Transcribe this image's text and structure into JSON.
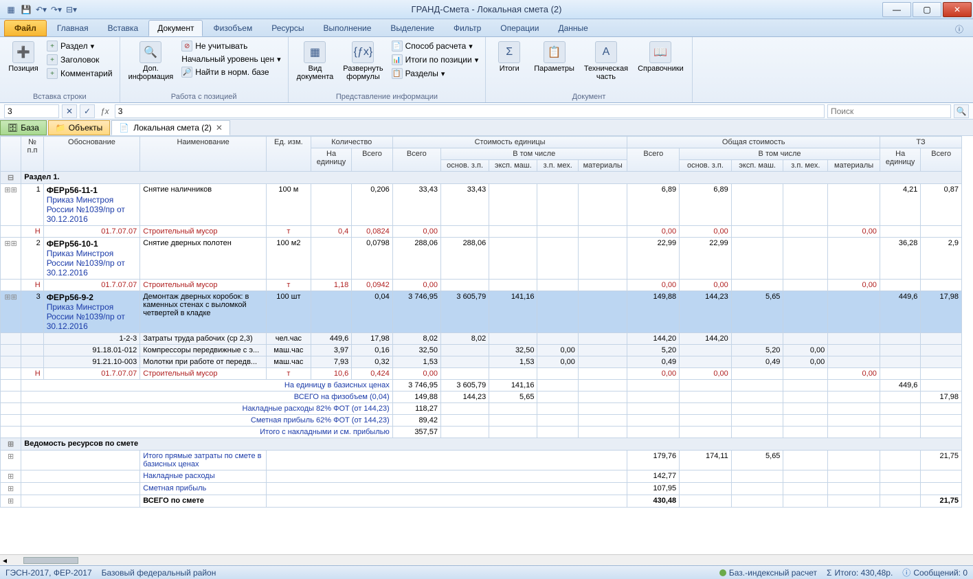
{
  "title": "ГРАНД-Смета - Локальная смета (2)",
  "ribbon": {
    "file": "Файл",
    "tabs": [
      "Главная",
      "Вставка",
      "Документ",
      "Физобъем",
      "Ресурсы",
      "Выполнение",
      "Выделение",
      "Фильтр",
      "Операции",
      "Данные"
    ],
    "active": "Документ",
    "g1": {
      "title": "Вставка строки",
      "pos": "Позиция",
      "razdel": "Раздел",
      "zag": "Заголовок",
      "kom": "Комментарий"
    },
    "g2": {
      "title": "Работа с позицией",
      "dop": "Доп.\nинформация",
      "neuch": "Не учитывать",
      "nach": "Начальный уровень цен",
      "find": "Найти в норм. базе"
    },
    "g3": {
      "title": "Представление информации",
      "vid": "Вид\nдокумента",
      "razv": "Развернуть\nформулы",
      "sposob": "Способ расчета",
      "itogipos": "Итоги по позиции",
      "razdely": "Разделы"
    },
    "g4": {
      "title": "Документ",
      "itogi": "Итоги",
      "param": "Параметры",
      "tech": "Техническая\nчасть",
      "sprav": "Справочники"
    }
  },
  "fbar": {
    "name": "3",
    "formula": "3",
    "search": "Поиск"
  },
  "tabstrip": {
    "baza": "База",
    "obj": "Объекты",
    "doc": "Локальная смета (2)"
  },
  "headers": {
    "num": "№\nп.п",
    "obos": "Обоснование",
    "naim": "Наименование",
    "ed": "Ед. изм.",
    "kol": "Количество",
    "kol_ed": "На\nединицу",
    "kol_vs": "Всего",
    "stoim": "Стоимость единицы",
    "vs": "Всего",
    "vtom": "В том числе",
    "osn": "основ. з.п.",
    "eksp": "эксп. маш.",
    "zpmeh": "з.п. мех.",
    "mat": "материалы",
    "obsh": "Общая стоимость",
    "tz": "ТЗ",
    "tz_ed": "На\nединицу",
    "tz_vs": "Всего"
  },
  "section1": "Раздел 1.",
  "rows": [
    {
      "n": "1",
      "code": "ФЕРр56-11-1",
      "prik": "Приказ Минстроя России №1039/пр от 30.12.2016",
      "name": "Снятие наличников",
      "ed": "100 м",
      "ke": "",
      "kv": "0,206",
      "se_vs": "33,43",
      "se_osn": "33,43",
      "se_em": "",
      "se_zpm": "",
      "se_mat": "",
      "o_vs": "6,89",
      "o_osn": "6,89",
      "o_em": "",
      "o_zpm": "",
      "o_mat": "",
      "tz_e": "4,21",
      "tz_v": "0,87"
    },
    {
      "type": "res",
      "h": "Н",
      "code": "01.7.07.07",
      "name": "Строительный мусор",
      "ed": "т",
      "ke": "0,4",
      "kv": "0,0824",
      "se_vs": "0,00",
      "o_vs": "0,00",
      "o_osn": "0,00",
      "o_mat": "0,00"
    },
    {
      "n": "2",
      "code": "ФЕРр56-10-1",
      "prik": "Приказ Минстроя России №1039/пр от 30.12.2016",
      "name": "Снятие дверных полотен",
      "ed": "100 м2",
      "ke": "",
      "kv": "0,0798",
      "se_vs": "288,06",
      "se_osn": "288,06",
      "o_vs": "22,99",
      "o_osn": "22,99",
      "tz_e": "36,28",
      "tz_v": "2,9"
    },
    {
      "type": "res",
      "h": "Н",
      "code": "01.7.07.07",
      "name": "Строительный мусор",
      "ed": "т",
      "ke": "1,18",
      "kv": "0,0942",
      "se_vs": "0,00",
      "o_vs": "0,00",
      "o_osn": "0,00",
      "o_mat": "0,00"
    },
    {
      "n": "3",
      "sel": true,
      "code": "ФЕРр56-9-2",
      "prik": "Приказ Минстроя России №1039/пр от 30.12.2016",
      "name": "Демонтаж дверных коробок: в каменных стенах с выломкой четвертей в кладке",
      "ed": "100 шт",
      "ke": "",
      "kv": "0,04",
      "se_vs": "3 746,95",
      "se_osn": "3 605,79",
      "se_em": "141,16",
      "o_vs": "149,88",
      "o_osn": "144,23",
      "o_em": "5,65",
      "tz_e": "449,6",
      "tz_v": "17,98"
    },
    {
      "type": "sub",
      "code": "1-2-3",
      "name": "Затраты труда рабочих (ср 2,3)",
      "ed": "чел.час",
      "ke": "449,6",
      "kv": "17,98",
      "se_vs": "8,02",
      "se_osn": "8,02",
      "o_vs": "144,20",
      "o_osn": "144,20"
    },
    {
      "type": "sub",
      "code": "91.18.01-012",
      "name": "Компрессоры передвижные с э...",
      "ed": "маш.час",
      "ke": "3,97",
      "kv": "0,16",
      "se_vs": "32,50",
      "se_em": "32,50",
      "se_zpm": "0,00",
      "o_vs": "5,20",
      "o_em": "5,20",
      "o_zpm": "0,00"
    },
    {
      "type": "sub",
      "code": "91.21.10-003",
      "name": "Молотки при работе от передв...",
      "ed": "маш.час",
      "ke": "7,93",
      "kv": "0,32",
      "se_vs": "1,53",
      "se_em": "1,53",
      "se_zpm": "0,00",
      "o_vs": "0,49",
      "o_em": "0,49",
      "o_zpm": "0,00"
    },
    {
      "type": "res",
      "h": "Н",
      "code": "01.7.07.07",
      "name": "Строительный мусор",
      "ed": "т",
      "ke": "10,6",
      "kv": "0,424",
      "se_vs": "0,00",
      "o_vs": "0,00",
      "o_osn": "0,00",
      "o_mat": "0,00"
    }
  ],
  "sumrows": [
    {
      "label": "На единицу в базисных ценах",
      "se_vs": "3 746,95",
      "se_osn": "3 605,79",
      "se_em": "141,16",
      "tz_e": "449,6"
    },
    {
      "label": "ВСЕГО на физобъем (0,04)",
      "se_vs": "149,88",
      "se_osn": "144,23",
      "se_em": "5,65",
      "tz_v": "17,98"
    },
    {
      "label": "Накладные расходы 82% ФОТ (от 144,23)",
      "se_vs": "118,27"
    },
    {
      "label": "Сметная прибыль 62% ФОТ (от 144,23)",
      "se_vs": "89,42"
    },
    {
      "label": "Итого с накладными и см. прибылью",
      "se_vs": "357,57"
    }
  ],
  "vedom": "Ведомость ресурсов по смете",
  "totrows": [
    {
      "label": "Итого прямые затраты по смете в базисных ценах",
      "o_vs": "179,76",
      "o_osn": "174,11",
      "o_em": "5,65",
      "tz_v": "21,75"
    },
    {
      "label": "Накладные расходы",
      "o_vs": "142,77"
    },
    {
      "label": "Сметная прибыль",
      "o_vs": "107,95"
    },
    {
      "label": "ВСЕГО по смете",
      "bold": true,
      "o_vs": "430,48",
      "tz_v": "21,75"
    }
  ],
  "status": {
    "left1": "ГЭСН-2017, ФЕР-2017",
    "left2": "Базовый федеральный район",
    "calc": "Баз.-индексный расчет",
    "sum": "Итого: 430,48р.",
    "msg": "Сообщений: 0"
  }
}
